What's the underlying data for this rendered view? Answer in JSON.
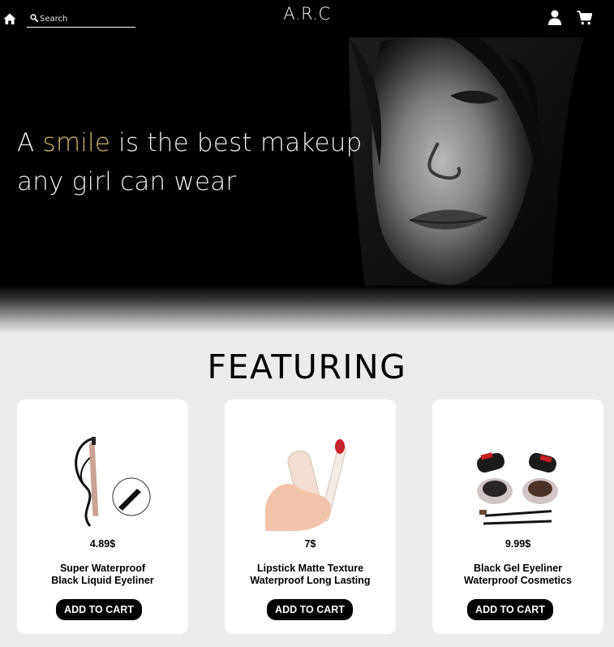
{
  "navbar": {
    "brand": "A.R.C",
    "search_placeholder": "Search",
    "home_icon": "home-icon",
    "search_icon": "search-icon",
    "user_icon": "user-icon",
    "cart_icon": "cart-icon"
  },
  "hero": {
    "line1_before": "A ",
    "line1_accent": "smile",
    "line1_after": " is the best makeup",
    "line2": "any girl can wear",
    "accent_color": "#d2b36b"
  },
  "featuring": {
    "title": "FEATURING",
    "products": [
      {
        "price": "4.89$",
        "name_line1": "Super Waterproof",
        "name_line2": "Black Liquid Eyeliner",
        "button": "ADD TO CART",
        "image": "liquid-eyeliner-image"
      },
      {
        "price": "7$",
        "name_line1": "Lipstick Matte Texture",
        "name_line2": "Waterproof Long Lasting",
        "button": "ADD TO CART",
        "image": "lip-tint-image"
      },
      {
        "price": "9.99$",
        "name_line1": "Black Gel Eyeliner",
        "name_line2": "Waterproof Cosmetics",
        "button": "ADD TO CART",
        "image": "gel-eyeliner-image"
      }
    ]
  }
}
